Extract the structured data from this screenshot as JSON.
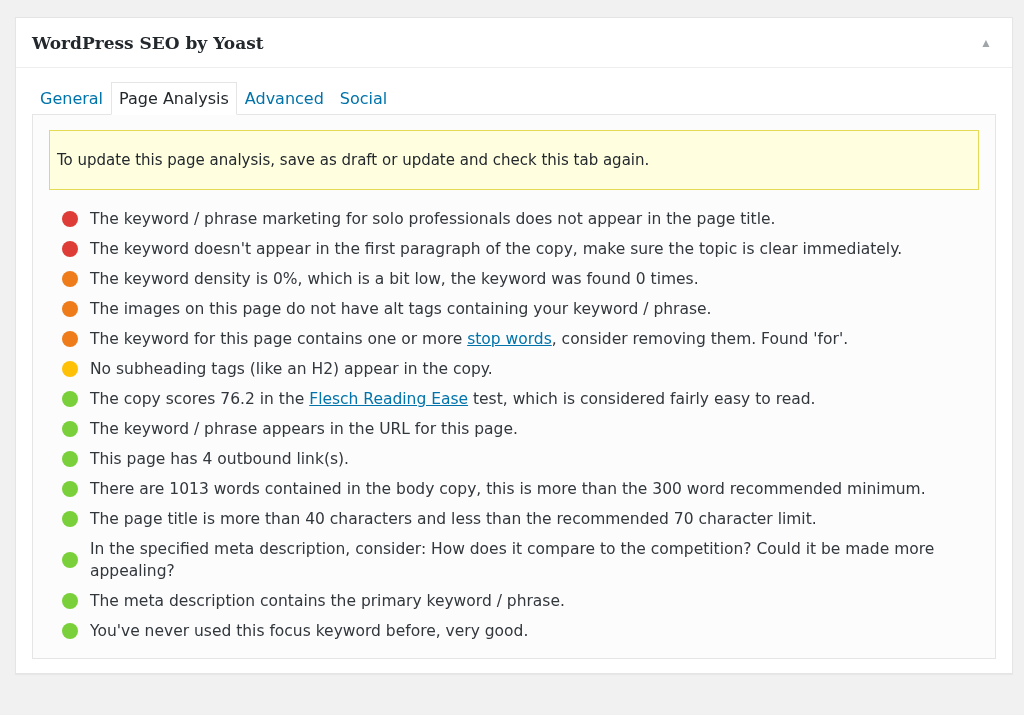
{
  "panel": {
    "title": "WordPress SEO by Yoast",
    "collapse_glyph": "▲"
  },
  "tabs": [
    {
      "label": "General",
      "selected": false
    },
    {
      "label": "Page Analysis",
      "selected": true
    },
    {
      "label": "Advanced",
      "selected": false
    },
    {
      "label": "Social",
      "selected": false
    }
  ],
  "notice": "To update this page analysis, save as draft or update and check this tab again.",
  "results": [
    {
      "color": "#dd3d36",
      "text": "The keyword / phrase marketing for solo professionals does not appear in the page title."
    },
    {
      "color": "#dd3d36",
      "text": "The keyword doesn't appear in the first paragraph of the copy, make sure the topic is clear immediately."
    },
    {
      "color": "#ee7c1b",
      "text": "The keyword density is 0%, which is a bit low, the keyword was found 0 times."
    },
    {
      "color": "#ee7c1b",
      "text": "The images on this page do not have alt tags containing your keyword / phrase."
    },
    {
      "color": "#ee7c1b",
      "text": "The keyword for this page contains one or more ",
      "link": "stop words",
      "after": ", consider removing them. Found 'for'."
    },
    {
      "color": "#ffc107",
      "text": "No subheading tags (like an H2) appear in the copy."
    },
    {
      "color": "#7ad03a",
      "text": "The copy scores 76.2 in the ",
      "link": "Flesch Reading Ease",
      "after": " test, which is considered fairly easy to read."
    },
    {
      "color": "#7ad03a",
      "text": "The keyword / phrase appears in the URL for this page."
    },
    {
      "color": "#7ad03a",
      "text": "This page has 4 outbound link(s)."
    },
    {
      "color": "#7ad03a",
      "text": "There are 1013 words contained in the body copy, this is more than the 300 word recommended minimum."
    },
    {
      "color": "#7ad03a",
      "text": "The page title is more than 40 characters and less than the recommended 70 character limit."
    },
    {
      "color": "#7ad03a",
      "text": "In the specified meta description, consider: How does it compare to the competition? Could it be made more appealing?"
    },
    {
      "color": "#7ad03a",
      "text": "The meta description contains the primary keyword / phrase."
    },
    {
      "color": "#7ad03a",
      "text": "You've never used this focus keyword before, very good."
    }
  ]
}
